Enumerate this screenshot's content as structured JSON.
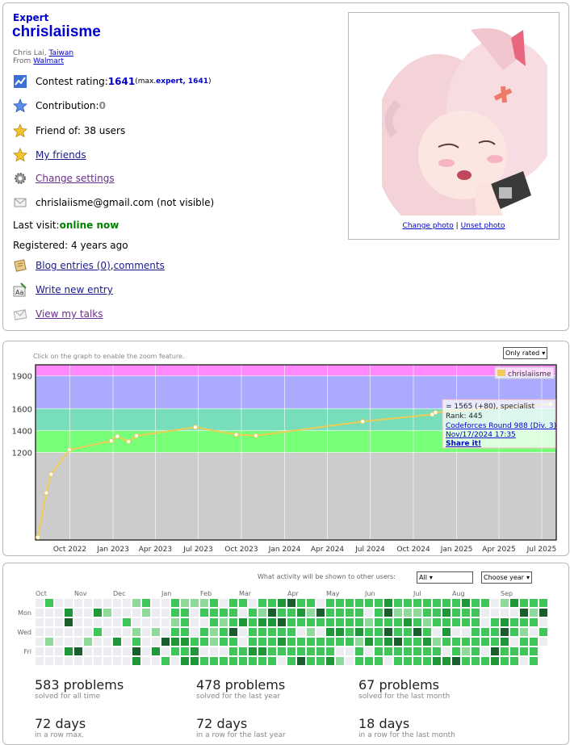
{
  "profile": {
    "rank": "Expert",
    "handle": "chrislaiisme",
    "name_prefix": "Chris Lai, ",
    "country": "Taiwan",
    "from_label": "From ",
    "organization": "Walmart",
    "rating_label": "Contest rating: ",
    "rating": "1641",
    "rating_max_prefix": " (max. ",
    "rating_max_title": "expert, 1641",
    "rating_max_suffix": ")",
    "contribution_label": "Contribution: ",
    "contribution": "0",
    "friend_of": "Friend of: 38 users",
    "my_friends": "My friends",
    "change_settings": "Change settings",
    "email": "chrislaiisme@gmail.com (not visible)",
    "last_visit_label": "Last visit: ",
    "last_visit": "online now",
    "registered": "Registered: 4 years ago",
    "blog_entries": "Blog entries (0)",
    "comma": ", ",
    "comments": "comments",
    "write_entry": "Write new entry",
    "view_talks": "View my talks",
    "change_photo": "Change photo",
    "unset_photo": "Unset photo",
    "separator": " | "
  },
  "graph": {
    "hint": "Click on the graph to enable the zoom feature.",
    "filter": "Only rated",
    "legend": "chrislaiisme",
    "tooltip": {
      "line1": "= 1565 (+80), specialist",
      "line2": "Rank: 445",
      "contest": "Codeforces Round 988 (Div. 3)",
      "date": "Nov/17/2024 17:35",
      "share": "Share it!"
    }
  },
  "chart_data": {
    "type": "line",
    "x_label_ticks": [
      "Oct 2022",
      "Jan 2023",
      "Apr 2023",
      "Jul 2023",
      "Oct 2023",
      "Jan 2024",
      "Apr 2024",
      "Jul 2024",
      "Oct 2024",
      "Jan 2025",
      "Apr 2025",
      "Jul 2025"
    ],
    "y_ticks": [
      1200,
      1400,
      1600,
      1900
    ],
    "ylim": [
      400,
      2000
    ],
    "bands": [
      {
        "from": 400,
        "to": 1200,
        "color": "#cccccc"
      },
      {
        "from": 1200,
        "to": 1400,
        "color": "#77ff77"
      },
      {
        "from": 1400,
        "to": 1600,
        "color": "#77ddbb"
      },
      {
        "from": 1600,
        "to": 1900,
        "color": "#aaaaff"
      },
      {
        "from": 1900,
        "to": 2000,
        "color": "#ff88ff"
      }
    ],
    "series": [
      {
        "name": "chrislaiisme",
        "color": "#eecc55",
        "points": [
          [
            "2022-07-25",
            425
          ],
          [
            "2022-08-12",
            830
          ],
          [
            "2022-08-22",
            1000
          ],
          [
            "2022-09-30",
            1223
          ],
          [
            "2022-12-28",
            1305
          ],
          [
            "2023-01-10",
            1347
          ],
          [
            "2023-02-03",
            1299
          ],
          [
            "2023-02-20",
            1352
          ],
          [
            "2023-06-25",
            1430
          ],
          [
            "2023-09-20",
            1362
          ],
          [
            "2023-11-01",
            1353
          ],
          [
            "2024-06-15",
            1482
          ],
          [
            "2024-11-10",
            1547
          ],
          [
            "2024-11-17",
            1565
          ],
          [
            "2025-07-20",
            1641
          ]
        ]
      }
    ]
  },
  "activity": {
    "visibility_label": "What activity will be shown to other users:",
    "visibility_value": "All",
    "year_select": "Choose year",
    "months": [
      "Oct",
      "Nov",
      "Dec",
      "Jan",
      "Feb",
      "Mar",
      "Apr",
      "May",
      "Jun",
      "Jul",
      "Aug",
      "Sep"
    ],
    "days": [
      "Mon",
      "Wed",
      "Fri"
    ],
    "stats": [
      {
        "value": "583 problems",
        "label": "solved for all time"
      },
      {
        "value": "478 problems",
        "label": "solved for the last year"
      },
      {
        "value": "67 problems",
        "label": "solved for the last month"
      },
      {
        "value": "72 days",
        "label": "in a row max."
      },
      {
        "value": "72 days",
        "label": "in a row for the last year"
      },
      {
        "value": "18 days",
        "label": "in a row for the last month"
      }
    ],
    "colors": {
      "empty": "#ebedf0",
      "l1": "#8fd99b",
      "l2": "#3fc65a",
      "l3": "#1f9638",
      "l4": "#1b5e2e"
    }
  }
}
